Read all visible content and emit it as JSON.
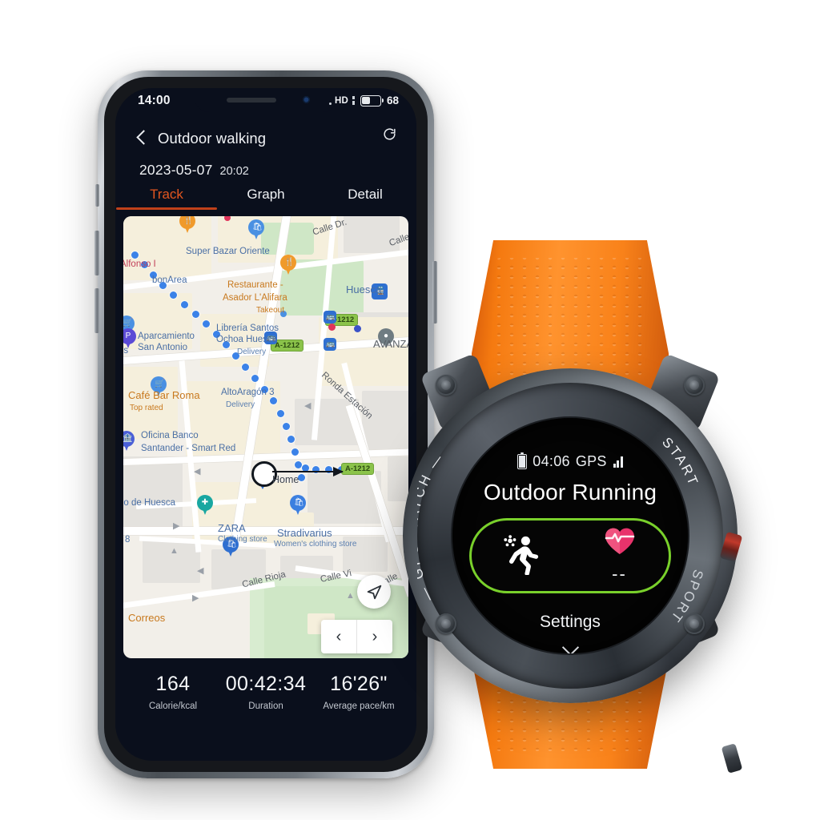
{
  "phone": {
    "status_bar": {
      "time": "14:00",
      "network": "HD",
      "battery_percent": "68"
    },
    "header": {
      "title": "Outdoor walking",
      "back_icon": "chevron-left-icon",
      "refresh_icon": "refresh-icon"
    },
    "session": {
      "date": "2023-05-07",
      "time": "20:02"
    },
    "tabs": [
      {
        "label": "Track",
        "active": true
      },
      {
        "label": "Graph",
        "active": false
      },
      {
        "label": "Detail",
        "active": false
      }
    ],
    "accent_color": "#e2561f",
    "map": {
      "home_label": "Home",
      "locate_icon": "navigation-arrow-icon",
      "pager": {
        "prev": "‹",
        "next": "›"
      },
      "highway_shields": [
        "A-1212",
        "A-1212",
        "A-1212"
      ],
      "labels": [
        {
          "text": "Alfonso I",
          "type": "street"
        },
        {
          "text": "Super Bazar Oriente",
          "type": "poi"
        },
        {
          "text": "bonArea",
          "type": "poi"
        },
        {
          "text": "Restaurante -",
          "type": "poi-orange"
        },
        {
          "text": "Asador L'Alifara",
          "type": "poi-orange"
        },
        {
          "text": "Takeout",
          "type": "sub-orange"
        },
        {
          "text": "Huesca",
          "type": "station"
        },
        {
          "text": "Aparcamiento",
          "type": "poi"
        },
        {
          "text": "San Antonio",
          "type": "poi"
        },
        {
          "text": "Librería Santos",
          "type": "poi"
        },
        {
          "text": "Ochoa Huesca",
          "type": "poi"
        },
        {
          "text": "Delivery",
          "type": "sub"
        },
        {
          "text": "AVANZA",
          "type": "poi-dark"
        },
        {
          "text": "AltoAragón 3",
          "type": "poi"
        },
        {
          "text": "Delivery",
          "type": "sub"
        },
        {
          "text": "Ronda Estación",
          "type": "street-dark"
        },
        {
          "text": "Café Bar Roma",
          "type": "poi-orange"
        },
        {
          "text": "Top rated",
          "type": "sub-orange"
        },
        {
          "text": "Oficina Banco",
          "type": "poi"
        },
        {
          "text": "Santander - Smart Red",
          "type": "poi"
        },
        {
          "text": "no de Huesca",
          "type": "poi"
        },
        {
          "text": "8",
          "type": "poi"
        },
        {
          "text": "ZARA",
          "type": "poi"
        },
        {
          "text": "Clothing store",
          "type": "sub"
        },
        {
          "text": "Stradivarius",
          "type": "poi"
        },
        {
          "text": "Women's clothing store",
          "type": "sub"
        },
        {
          "text": "Calle Rioja",
          "type": "street-dark"
        },
        {
          "text": "Calle Vi",
          "type": "street-dark"
        },
        {
          "text": "Calle Dr.",
          "type": "street-dark"
        },
        {
          "text": "Calle",
          "type": "street-dark"
        },
        {
          "text": "Calle P",
          "type": "street-dark"
        },
        {
          "text": "Correos",
          "type": "poi-orange"
        },
        {
          "text": "os",
          "type": "poi"
        }
      ]
    },
    "stats": [
      {
        "value": "164",
        "label": "Calorie/kcal"
      },
      {
        "value": "00:42:34",
        "label": "Duration"
      },
      {
        "value": "16'26\"",
        "label": "Average pace/km"
      }
    ]
  },
  "watch": {
    "status": {
      "time": "04:06",
      "gps_label": "GPS",
      "battery_icon": "battery-icon",
      "signal_icon": "signal-bars-icon"
    },
    "title": "Outdoor Running",
    "card": {
      "border_color": "#79d02b",
      "metrics": [
        {
          "icon": "running-person-icon",
          "value": ""
        },
        {
          "icon": "heart-rate-icon",
          "value": "--"
        }
      ]
    },
    "settings_label": "Settings",
    "chevron_icon": "chevron-down-icon",
    "bezel": {
      "left": "GPS WATCH",
      "top_right": "START",
      "bottom_right": "SPORT"
    },
    "strap_color": "#f57a10"
  }
}
